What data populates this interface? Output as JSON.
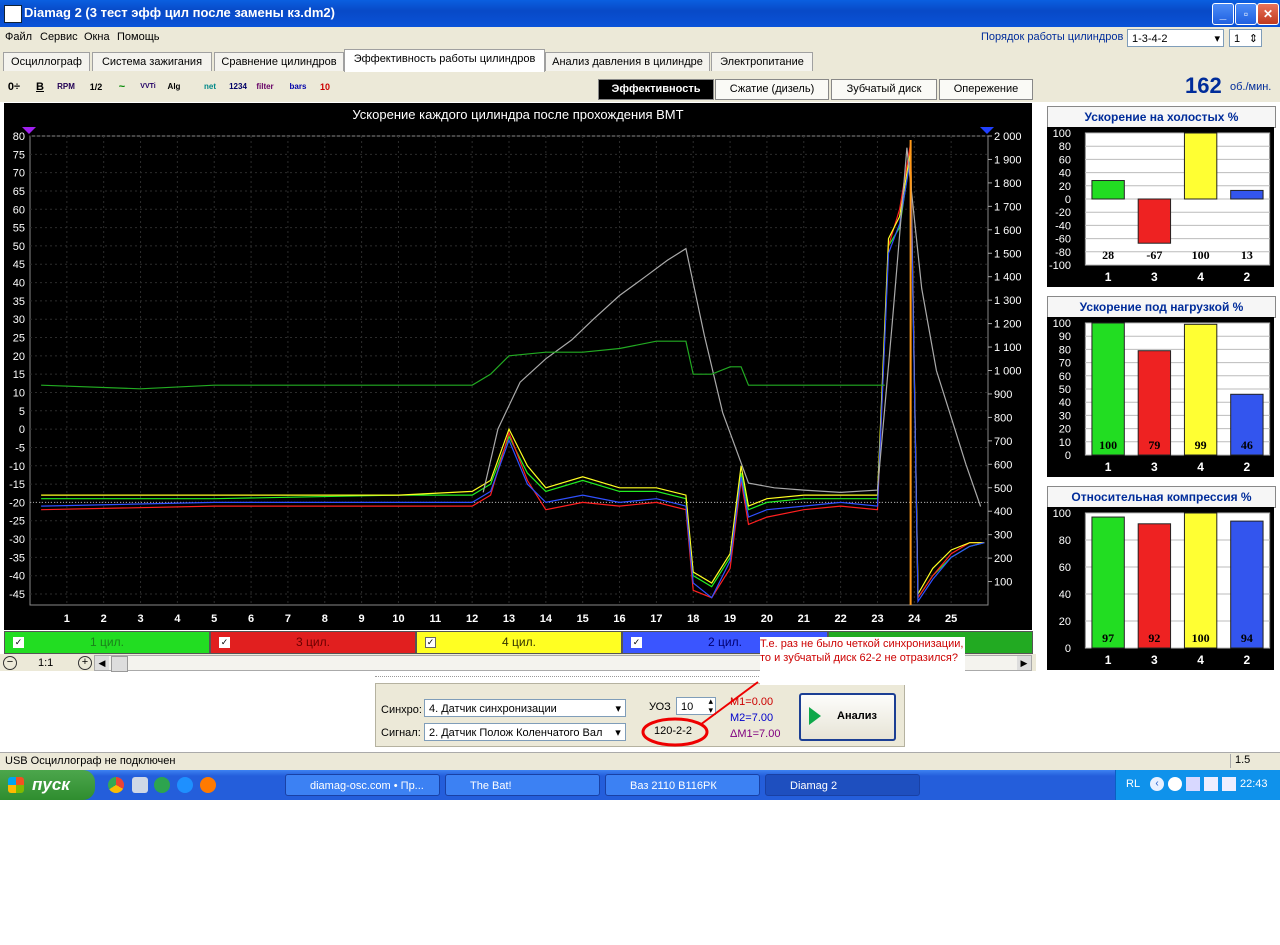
{
  "window": {
    "title": "Diamag 2 (3 тест эфф цил после замены кз.dm2)"
  },
  "menu": {
    "items": [
      "Файл",
      "Сервис",
      "Окна",
      "Помощь"
    ],
    "order_label": "Порядок работы цилиндров",
    "order_value": "1-3-4-2",
    "order_num": "1"
  },
  "tabs": [
    "Осциллограф",
    "Система зажигания",
    "Сравнение цилиндров",
    "Эффективность работы цилиндров",
    "Анализ давления в цилиндре",
    "Электропитание"
  ],
  "toolbar": {
    "icons": [
      "0÷",
      "B",
      "RPM",
      "1/2",
      "~",
      "VVTi",
      "Alg 1/2",
      "net",
      "1234",
      "filter",
      "bars",
      "10"
    ]
  },
  "subtabs": [
    "Эффективность",
    "Сжатие (дизель)",
    "Зубчатый диск",
    "Опережение"
  ],
  "rpm": {
    "value": "162",
    "unit": "об./мин."
  },
  "legend": [
    {
      "label": "1 цил.",
      "color": "#22dd22",
      "text_color": "#1a801a"
    },
    {
      "label": "3 цил.",
      "color": "#e11f1f",
      "text_color": "#5a0000"
    },
    {
      "label": "4 цил.",
      "color": "#ffff22",
      "text_color": "#333300"
    },
    {
      "label": "2 цил.",
      "color": "#3a55ff",
      "text_color": "#000070"
    }
  ],
  "zoom": {
    "label": "1:1"
  },
  "annotation": {
    "text": "Т.е. раз не было четкой синхронизации, то и зубчатый диск 62-2 не отразился?",
    "highlight": "120-2-2"
  },
  "controls": {
    "sync_label": "Синхро:",
    "sync_value": "4.  Датчик синхронизации",
    "signal_label": "Сигнал:",
    "signal_value": "2.  Датчик Полож Коленчатого Вал",
    "uoz_label": "УОЗ",
    "uoz_value": "10",
    "disk_value": "120-2-2",
    "m1": "M1=0.00",
    "m2": "M2=7.00",
    "dm1": "ΔM1=7.00",
    "analyze_label": "Анализ"
  },
  "status": {
    "text": "USB Осциллограф не подключен",
    "right": "1.5"
  },
  "taskbar": {
    "start": "пуск",
    "tasks": [
      "diamag-osc.com • Пр...",
      "The Bat!",
      "Ваз 2110 В116РК",
      "Diamag 2"
    ],
    "lang": "RL",
    "time": "22:43"
  },
  "chart_data": [
    {
      "type": "line",
      "title": "Ускорение каждого цилиндра после прохождения ВМТ",
      "x_ticks": [
        "1",
        "2",
        "3",
        "4",
        "5",
        "6",
        "7",
        "8",
        "9",
        "10",
        "11",
        "12",
        "13",
        "14",
        "15",
        "16",
        "17",
        "18",
        "19",
        "20",
        "21",
        "22",
        "23",
        "24",
        "25"
      ],
      "y_left": {
        "min": -48,
        "max": 80,
        "ticks": [
          80,
          75,
          70,
          65,
          60,
          55,
          50,
          45,
          40,
          35,
          30,
          25,
          20,
          15,
          10,
          5,
          0,
          -5,
          -10,
          -15,
          -20,
          -25,
          -30,
          -35,
          -40,
          -45
        ]
      },
      "y_right": {
        "min": 0,
        "max": 2000,
        "ticks": [
          "2 000",
          "1 900",
          "1 800",
          "1 700",
          "1 600",
          "1 500",
          "1 400",
          "1 300",
          "1 200",
          "1 100",
          "1 000",
          "900",
          "800",
          "700",
          "600",
          "500",
          "400",
          "300",
          "200",
          "100"
        ]
      },
      "series": [
        {
          "name": "1 цил.",
          "color": "#22ee22",
          "x": [
            0.3,
            5,
            10,
            12,
            12.5,
            13,
            13.5,
            14,
            15,
            16,
            17,
            17.8,
            18,
            18.5,
            19,
            19.3,
            19.5,
            20,
            21,
            22,
            23,
            23.3,
            23.6,
            23.9,
            24.1,
            24.5,
            25,
            25.5,
            25.9
          ],
          "y": [
            -19,
            -19,
            -18,
            -18,
            -15,
            -2,
            -12,
            -17,
            -14,
            -17,
            -17,
            -19,
            -40,
            -43,
            -35,
            -12,
            -22,
            -20,
            -19,
            -19,
            -19,
            50,
            55,
            75,
            -46,
            -40,
            -35,
            -32,
            -31
          ]
        },
        {
          "name": "3 цил.",
          "color": "#ff2020",
          "x": [
            0.3,
            5,
            10,
            12,
            12.5,
            13,
            13.5,
            14,
            15,
            16,
            17,
            17.8,
            18,
            18.5,
            19,
            19.3,
            19.5,
            20,
            21,
            22,
            23,
            23.3,
            23.6,
            23.9,
            24.1,
            24.5,
            25,
            25.5,
            25.9
          ],
          "y": [
            -22,
            -21,
            -21,
            -21,
            -18,
            -1,
            -14,
            -22,
            -20,
            -21,
            -20,
            -22,
            -44,
            -46,
            -38,
            -14,
            -26,
            -24,
            -22,
            -21,
            -22,
            50,
            60,
            78,
            -46,
            -40,
            -34,
            -31,
            -31
          ]
        },
        {
          "name": "4 цил.",
          "color": "#ffff22",
          "x": [
            0.3,
            5,
            10,
            12,
            12.5,
            13,
            13.5,
            14,
            15,
            16,
            17,
            17.8,
            18,
            18.5,
            19,
            19.3,
            19.5,
            20,
            21,
            22,
            23,
            23.3,
            23.6,
            23.9,
            24.1,
            24.5,
            25,
            25.5,
            25.9
          ],
          "y": [
            -18,
            -18,
            -18,
            -17,
            -14,
            0,
            -10,
            -16,
            -13,
            -16,
            -16,
            -18,
            -39,
            -42,
            -34,
            -10,
            -21,
            -19,
            -18,
            -18,
            -18,
            52,
            58,
            76,
            -45,
            -38,
            -33,
            -31,
            -31
          ]
        },
        {
          "name": "2 цил.",
          "color": "#3050ff",
          "x": [
            0.3,
            5,
            10,
            12,
            12.5,
            13,
            13.5,
            14,
            15,
            16,
            17,
            17.8,
            18,
            18.5,
            19,
            19.3,
            19.5,
            20,
            21,
            22,
            23,
            23.3,
            23.6,
            23.9,
            24.1,
            24.5,
            25,
            25.5,
            25.9
          ],
          "y": [
            -21,
            -20,
            -20,
            -20,
            -17,
            -3,
            -15,
            -20,
            -18,
            -20,
            -19,
            -21,
            -42,
            -46,
            -36,
            -13,
            -24,
            -22,
            -21,
            -20,
            -21,
            48,
            56,
            74,
            -47,
            -41,
            -35,
            -32,
            -31
          ]
        },
        {
          "name": "RPM",
          "color": "#aaaaaa",
          "axis": "right",
          "x": [
            12.3,
            12.7,
            13.3,
            14,
            14.7,
            15.3,
            16,
            16.7,
            17.3,
            17.8,
            18.3,
            18.8,
            19.5,
            20.2,
            21,
            22,
            23,
            23.4,
            23.8,
            24.2,
            24.6,
            25,
            25.4,
            25.8
          ],
          "y": [
            480,
            750,
            950,
            1050,
            1130,
            1220,
            1320,
            1400,
            1470,
            1520,
            1150,
            820,
            520,
            500,
            490,
            480,
            490,
            1200,
            1950,
            1350,
            1000,
            800,
            600,
            420
          ]
        },
        {
          "name": "green-ref",
          "color": "#22aa22",
          "x": [
            0.3,
            3,
            5,
            8,
            10,
            12,
            12.5,
            13,
            14,
            15,
            16,
            17,
            17.8,
            18,
            18.5,
            19,
            19.3,
            19.5,
            20,
            21,
            22,
            23,
            23.2
          ],
          "y": [
            12,
            11,
            12,
            12,
            12,
            12,
            15,
            20,
            21,
            21,
            22,
            24,
            24,
            15,
            15,
            17,
            17,
            12,
            12,
            12,
            12,
            12,
            12
          ]
        }
      ]
    },
    {
      "type": "bar",
      "title": "Ускорение на холостых %",
      "categories": [
        "1",
        "3",
        "4",
        "2"
      ],
      "values": [
        28,
        -67,
        100,
        13
      ],
      "colors": [
        "#22dd22",
        "#ee2222",
        "#ffff33",
        "#3355ee"
      ],
      "ylim": [
        -100,
        100
      ],
      "yticks": [
        100,
        80,
        60,
        40,
        20,
        0,
        -20,
        -40,
        -60,
        -80,
        -100
      ]
    },
    {
      "type": "bar",
      "title": "Ускорение под нагрузкой %",
      "categories": [
        "1",
        "3",
        "4",
        "2"
      ],
      "values": [
        100,
        79,
        99,
        46
      ],
      "colors": [
        "#22dd22",
        "#ee2222",
        "#ffff33",
        "#3355ee"
      ],
      "ylim": [
        0,
        100
      ],
      "yticks": [
        100,
        90,
        80,
        70,
        60,
        50,
        40,
        30,
        20,
        10,
        0
      ]
    },
    {
      "type": "bar",
      "title": "Относительная компрессия %",
      "categories": [
        "1",
        "3",
        "4",
        "2"
      ],
      "values": [
        97,
        92,
        100,
        94
      ],
      "colors": [
        "#22dd22",
        "#ee2222",
        "#ffff33",
        "#3355ee"
      ],
      "ylim": [
        0,
        100
      ],
      "yticks": [
        100,
        80,
        60,
        40,
        20,
        0
      ]
    }
  ]
}
